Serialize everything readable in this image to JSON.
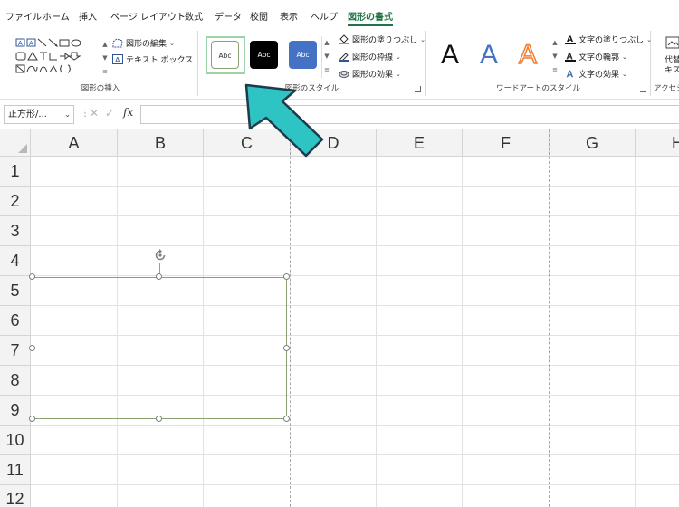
{
  "tabs": [
    {
      "label": "ファイル"
    },
    {
      "label": "ホーム"
    },
    {
      "label": "挿入"
    },
    {
      "label": "ページ レイアウト"
    },
    {
      "label": "数式"
    },
    {
      "label": "データ"
    },
    {
      "label": "校閲"
    },
    {
      "label": "表示"
    },
    {
      "label": "ヘルプ"
    },
    {
      "label": "図形の書式"
    }
  ],
  "ribbon": {
    "insert_group": {
      "label": "図形の挿入",
      "edit_shape": "図形の編集",
      "text_box": "テキスト ボックス"
    },
    "style_group": {
      "label": "図形のスタイル",
      "style_sample": "Abc",
      "fill": "図形の塗りつぶし",
      "outline": "図形の枠線",
      "effects": "図形の効果"
    },
    "wordart_group": {
      "label": "ワードアートのスタイル",
      "letter": "A",
      "text_fill": "文字の塗りつぶし",
      "text_outline": "文字の輪郭",
      "text_effects": "文字の効果"
    },
    "accessibility_group": {
      "label": "アクセシビ",
      "alt_text_1": "代替",
      "alt_text_2": "キス"
    }
  },
  "formula_bar": {
    "name_box": "正方形/...",
    "fx": "fx",
    "formula": ""
  },
  "grid": {
    "columns": [
      "A",
      "B",
      "C",
      "D",
      "E",
      "F",
      "G",
      "H"
    ],
    "rows": [
      "1",
      "2",
      "3",
      "4",
      "5",
      "6",
      "7",
      "8",
      "9",
      "10",
      "11",
      "12"
    ]
  },
  "colors": {
    "accent": "#217346",
    "arrow": "#2ec4c4",
    "shape_outline": "#8aa070",
    "style_blue": "#4472c4",
    "wordart_blue": "#4472c4",
    "wordart_orange": "#ed7d31"
  }
}
